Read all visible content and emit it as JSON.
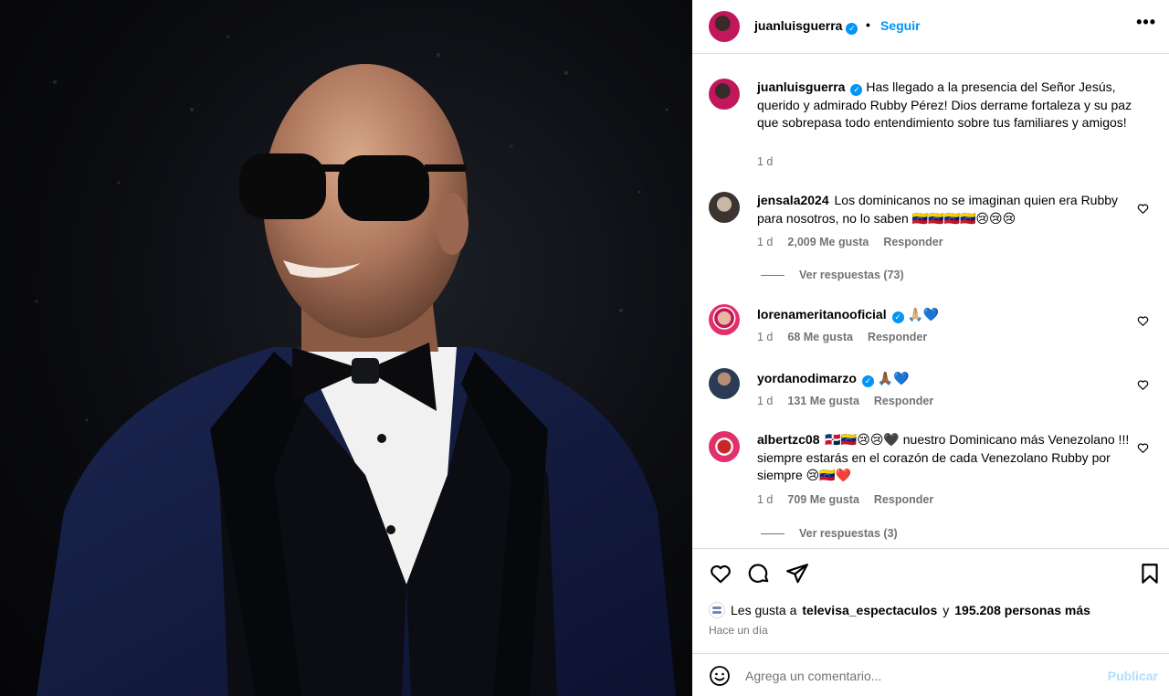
{
  "post": {
    "photo_alt": "",
    "header": {
      "username": "juanluisguerra",
      "verified": true,
      "separator": "•",
      "follow_label": "Seguir",
      "more_icon": "more-horizontal-icon"
    }
  },
  "comments": [
    {
      "username": "juanluisguerra",
      "verified": true,
      "text": "Has llegado a la presencia del Señor Jesús, querido y admirado Rubby Pérez! Dios derrame fortaleza y su paz que sobrepasa todo entendimiento sobre tus familiares y amigos!",
      "time": "1 d"
    },
    {
      "username": "jensala2024",
      "verified": false,
      "text": "Los dominicanos no se imaginan quien era Rubby para nosotros, no lo saben 🇻🇪🇻🇪🇻🇪🇻🇪😢😢😢",
      "time": "1 d",
      "likes": "2,009 Me gusta",
      "reply_label": "Responder",
      "replies_label": "Ver respuestas (73)"
    },
    {
      "username": "lorenameritanooficial",
      "verified": true,
      "text": "🙏🏼💙",
      "time": "1 d",
      "likes": "68 Me gusta",
      "reply_label": "Responder"
    },
    {
      "username": "yordanodimarzo",
      "verified": true,
      "text": "🙏🏾💙",
      "time": "1 d",
      "likes": "131 Me gusta",
      "reply_label": "Responder"
    },
    {
      "username": "albertzc08",
      "verified": false,
      "text": "🇩🇴🇻🇪😢😢🖤 nuestro Dominicano más Venezolano !!! siempre estarás en el corazón de cada Venezolano Rubby por siempre 😢🇻🇪❤️",
      "time": "1 d",
      "likes": "709 Me gusta",
      "reply_label": "Responder",
      "replies_label": "Ver respuestas (3)"
    }
  ],
  "actions": {
    "like_icon": "heart-icon",
    "comment_icon": "comment-icon",
    "share_icon": "share-icon",
    "save_icon": "bookmark-icon"
  },
  "likes_summary": {
    "prefix": "Les gusta a",
    "liker": "televisa_espectaculos",
    "connector": "y",
    "others": "195.208 personas más"
  },
  "posted_time": "Hace un día",
  "comment_box": {
    "placeholder": "Agrega un comentario...",
    "publish_label": "Publicar"
  },
  "colors": {
    "accent": "#0095f6",
    "muted_text": "#737373",
    "border": "#dbdbdb",
    "publish_disabled": "#b2dffc"
  }
}
